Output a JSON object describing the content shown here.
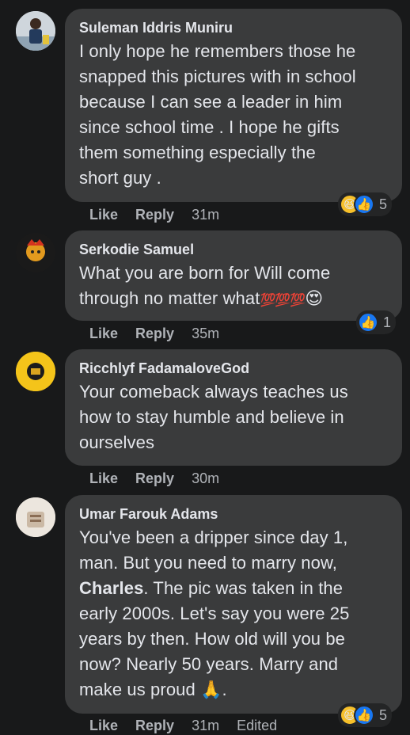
{
  "comments": [
    {
      "author": "Suleman Iddris Muniru",
      "lines": [
        "I only hope he remembers those he",
        "snapped this pictures with in school",
        "because I can see a leader in him",
        "since school time . I hope he gifts",
        "them something especially the",
        "short guy ."
      ],
      "like": "Like",
      "reply": "Reply",
      "time": "31m",
      "reaction_count": "5"
    },
    {
      "author": "Serkodie Samuel",
      "line1": "What you are born for Will come",
      "line2": "through no matter what",
      "emoji_100": "💯💯💯",
      "emoji_end": "😍",
      "like": "Like",
      "reply": "Reply",
      "time": "35m",
      "reaction_count": "1"
    },
    {
      "author": "Ricchlyf FadamaloveGod",
      "lines": [
        "Your comeback always teaches us",
        "how to stay humble and believe in",
        "ourselves"
      ],
      "like": "Like",
      "reply": "Reply",
      "time": "30m"
    },
    {
      "author": "Umar Farouk Adams",
      "line1": "You've been a dripper since day 1,",
      "line2": "man. But you need to marry now,",
      "bold_name": "Charles",
      "line3_rest": ". The pic was taken in the",
      "line4": "early 2000s. Let's say you were 25",
      "line5": "years by then. How old will you be",
      "line6": "now? Nearly 50 years. Marry and",
      "line7": "make us proud ",
      "line7_emoji": "🙏",
      "line7_end": ".",
      "like": "Like",
      "reply": "Reply",
      "time": "31m",
      "edited": "Edited",
      "reaction_count": "5"
    }
  ],
  "icons": {
    "like": "like-reaction-icon",
    "haha": "haha-reaction-icon"
  },
  "colors": {
    "background": "#18191a",
    "bubble": "#3a3b3c",
    "like_blue": "#1877f2",
    "meta_gray": "#b0b3b8"
  }
}
